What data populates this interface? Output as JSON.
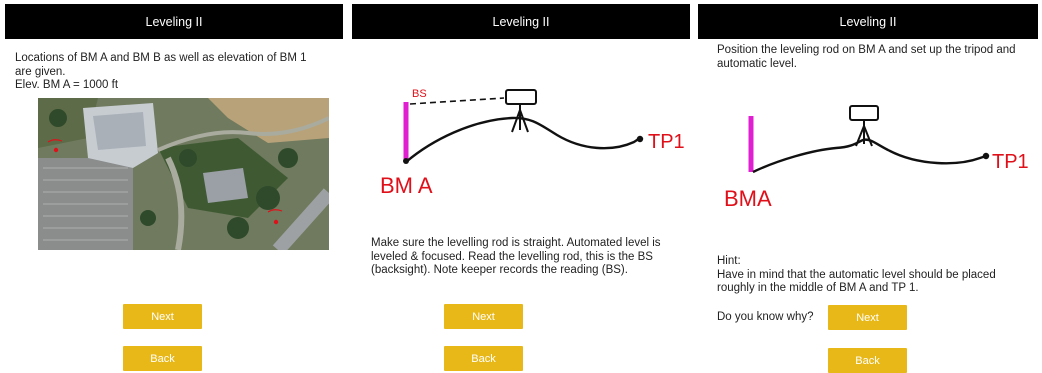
{
  "panels": [
    {
      "title": "Leveling II",
      "text_line1": "Locations of BM A and BM B as well as elevation of BM 1",
      "text_line2": "are given.",
      "text_line3": "Elev. BM A = 1000 ft",
      "next_label": "Next",
      "back_label": "Back"
    },
    {
      "title": "Leveling II",
      "sketch_label_bs": "BS",
      "sketch_label_bma": "BM A",
      "sketch_label_tp1": "TP1",
      "text_line1": "Make sure the levelling rod is straight. Automated level is",
      "text_line2": "leveled & focused. Read the levelling rod, this is the BS",
      "text_line3": "(backsight). Note keeper records the reading (BS).",
      "next_label": "Next",
      "back_label": "Back"
    },
    {
      "title": "Leveling II",
      "text_line1": "Position the leveling rod on BM A and set up the tripod and",
      "text_line2": "automatic level.",
      "sketch_label_bma": "BMA",
      "sketch_label_tp1": "TP1",
      "hint_title": "Hint:",
      "hint_line1": "Have in mind that the automatic level should be placed",
      "hint_line2": "roughly in the middle of BM A and TP 1.",
      "question": "Do you know why?",
      "next_label": "Next",
      "back_label": "Back"
    }
  ],
  "colors": {
    "titlebar": "#000000",
    "button": "#e8b818",
    "rod": "#e020d0",
    "sketch_red": "#e0101a"
  }
}
